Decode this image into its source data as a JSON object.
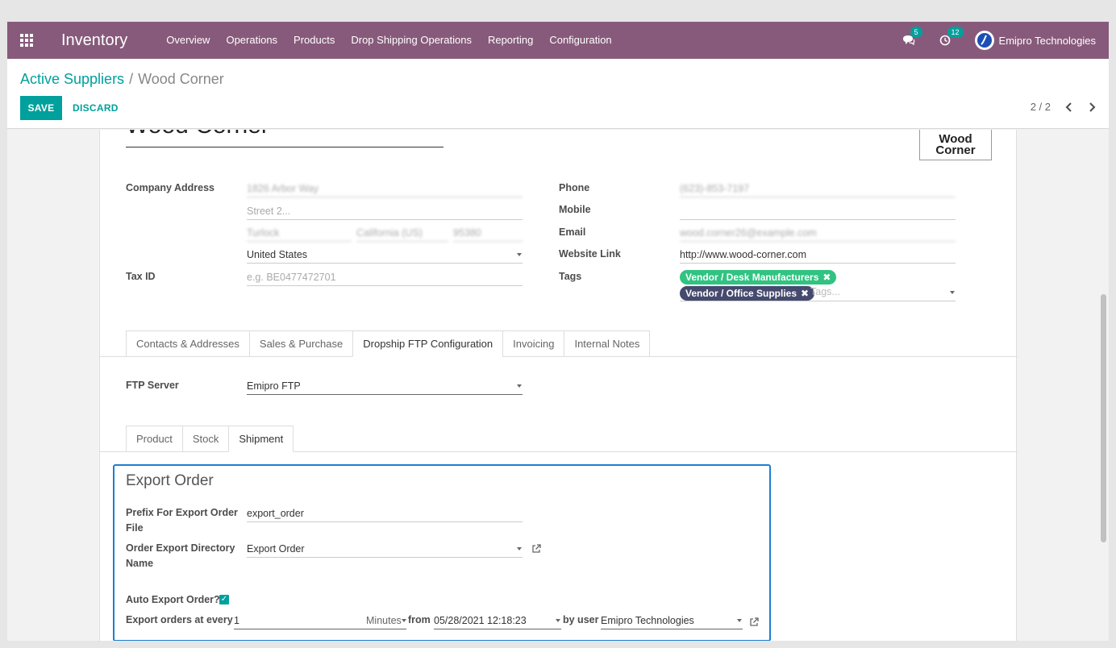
{
  "navbar": {
    "app_name": "Inventory",
    "menu": [
      "Overview",
      "Operations",
      "Products",
      "Drop Shipping Operations",
      "Reporting",
      "Configuration"
    ],
    "messages_count": "5",
    "activities_count": "12",
    "user_name": "Emipro Technologies",
    "color": "#875a7b"
  },
  "control_panel": {
    "breadcrumb_parent": "Active Suppliers",
    "breadcrumb_separator": "/",
    "breadcrumb_current": "Wood Corner",
    "save_label": "SAVE",
    "discard_label": "DISCARD",
    "pager": "2 / 2",
    "accent": "#00a09d"
  },
  "record": {
    "name": "Wood Corner",
    "logo_text_line1": "Wood",
    "logo_text_line2": "Corner"
  },
  "address": {
    "label": "Company Address",
    "street": "1826 Arbor Way",
    "street2_placeholder": "Street 2...",
    "city": "Turlock",
    "state": "California (US)",
    "zip": "95380",
    "country": "United States",
    "tax_label": "Tax ID",
    "tax_placeholder": "e.g. BE0477472701"
  },
  "contact": {
    "phone_label": "Phone",
    "phone": "(623)-853-7197",
    "mobile_label": "Mobile",
    "email_label": "Email",
    "email": "wood.corner26@example.com",
    "website_label": "Website Link",
    "website": "http://www.wood-corner.com",
    "tags_label": "Tags",
    "tags": [
      {
        "name": "Vendor / Desk Manufacturers",
        "color": "#30c381"
      },
      {
        "name": "Vendor / Office Supplies",
        "color": "#454a6e"
      }
    ],
    "tags_placeholder": "Tags..."
  },
  "tabs": [
    "Contacts & Addresses",
    "Sales & Purchase",
    "Dropship FTP Configuration",
    "Invoicing",
    "Internal Notes"
  ],
  "active_tab": "Dropship FTP Configuration",
  "ftp": {
    "server_label": "FTP Server",
    "server_value": "Emipro FTP"
  },
  "subtabs": [
    "Product",
    "Stock",
    "Shipment"
  ],
  "active_subtab": "Shipment",
  "export_order": {
    "title": "Export Order",
    "prefix_label_1": "Prefix For Export Order",
    "prefix_label_2": "File",
    "prefix_value": "export_order",
    "dir_label_1": "Order Export Directory",
    "dir_label_2": "Name",
    "dir_value": "Export Order",
    "auto_label": "Auto Export Order?",
    "auto_checked": "✓",
    "every_label": "Export orders at every",
    "every_value": "1",
    "unit": "Minutes",
    "from_label": "from",
    "from_value": "05/28/2021 12:18:23",
    "user_label": "by user",
    "user_value": "Emipro Technologies"
  }
}
